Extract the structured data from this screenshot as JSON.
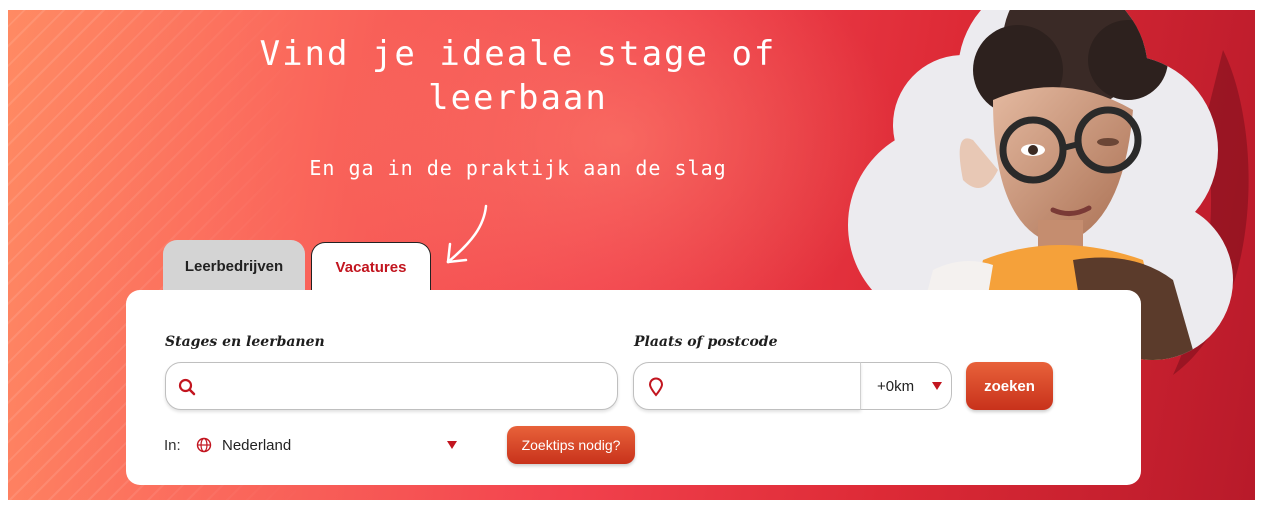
{
  "hero": {
    "headline_line1": "Vind je ideale stage of",
    "headline_line2": "leerbaan",
    "subline": "En ga in de praktijk aan de slag"
  },
  "tabs": [
    {
      "label": "Leerbedrijven",
      "active": false
    },
    {
      "label": "Vacatures",
      "active": true
    }
  ],
  "search": {
    "query_label": "Stages en leerbanen",
    "query_value": "",
    "query_placeholder": "",
    "location_label": "Plaats of postcode",
    "location_value": "",
    "location_placeholder": "",
    "radius_value": "+0km",
    "submit_label": "zoeken"
  },
  "country": {
    "prefix": "In:",
    "value": "Nederland"
  },
  "tips_button": "Zoektips nodig?",
  "icons": {
    "search": "search-icon",
    "location": "map-pin-icon",
    "globe": "globe-icon",
    "dropdown": "caret-down-icon",
    "arrow": "hand-drawn-arrow-icon"
  },
  "colors": {
    "accent": "#c2151f",
    "button": "#d9462a",
    "hero_start": "#ff8a63",
    "hero_end": "#b81a2a"
  }
}
